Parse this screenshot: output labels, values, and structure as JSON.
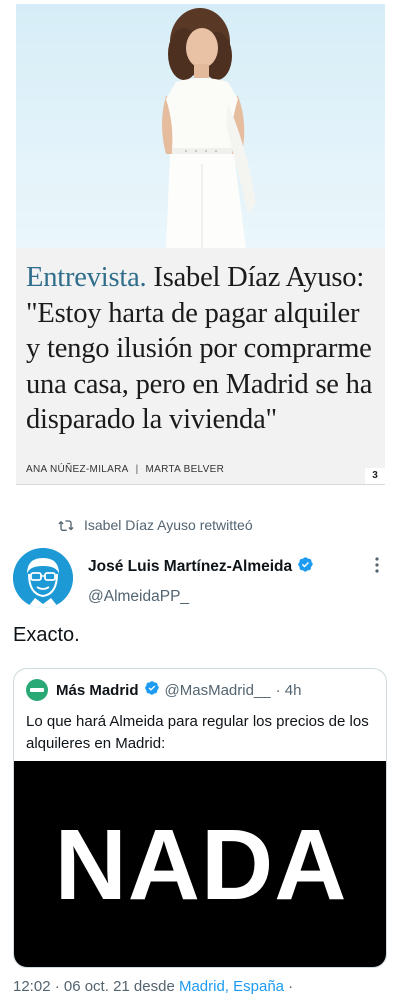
{
  "article": {
    "kicker": "Entrevista.",
    "headline": " Isabel Díaz Ayuso: \"Estoy harta de pagar alquiler y tengo ilusión por comprarme una casa, pero en Madrid se ha disparado la vivienda\"",
    "author1": "ANA NÚÑEZ-MILARA",
    "separator": "|",
    "author2": "MARTA BELVER",
    "page_number": "3"
  },
  "tweet": {
    "retweeted_by": "Isabel Díaz Ayuso retwitteó",
    "author_name": "José Luis Martínez-Almeida",
    "author_handle": "@AlmeidaPP_",
    "text": "Exacto.",
    "quote": {
      "author_name": "Más Madrid",
      "author_handle": "@MasMadrid__",
      "time": "· 4h",
      "text": "Lo que hará Almeida para regular los precios de los alquileres en Madrid:",
      "image_text": "NADA"
    },
    "footer": {
      "time_date": "12:02 · 06 oct. 21 desde ",
      "location": "Madrid, España",
      "trailing": " ·"
    }
  },
  "colors": {
    "kicker": "#2f6e8c",
    "verified": "#1d9bf0",
    "avatar_bg": "#1d9ad6",
    "mas_madrid": "#2aa876",
    "secondary_text": "#536471"
  },
  "icons": [
    "retweet-icon",
    "verified-badge-icon",
    "more-options-icon",
    "mas-madrid-logo-icon"
  ]
}
